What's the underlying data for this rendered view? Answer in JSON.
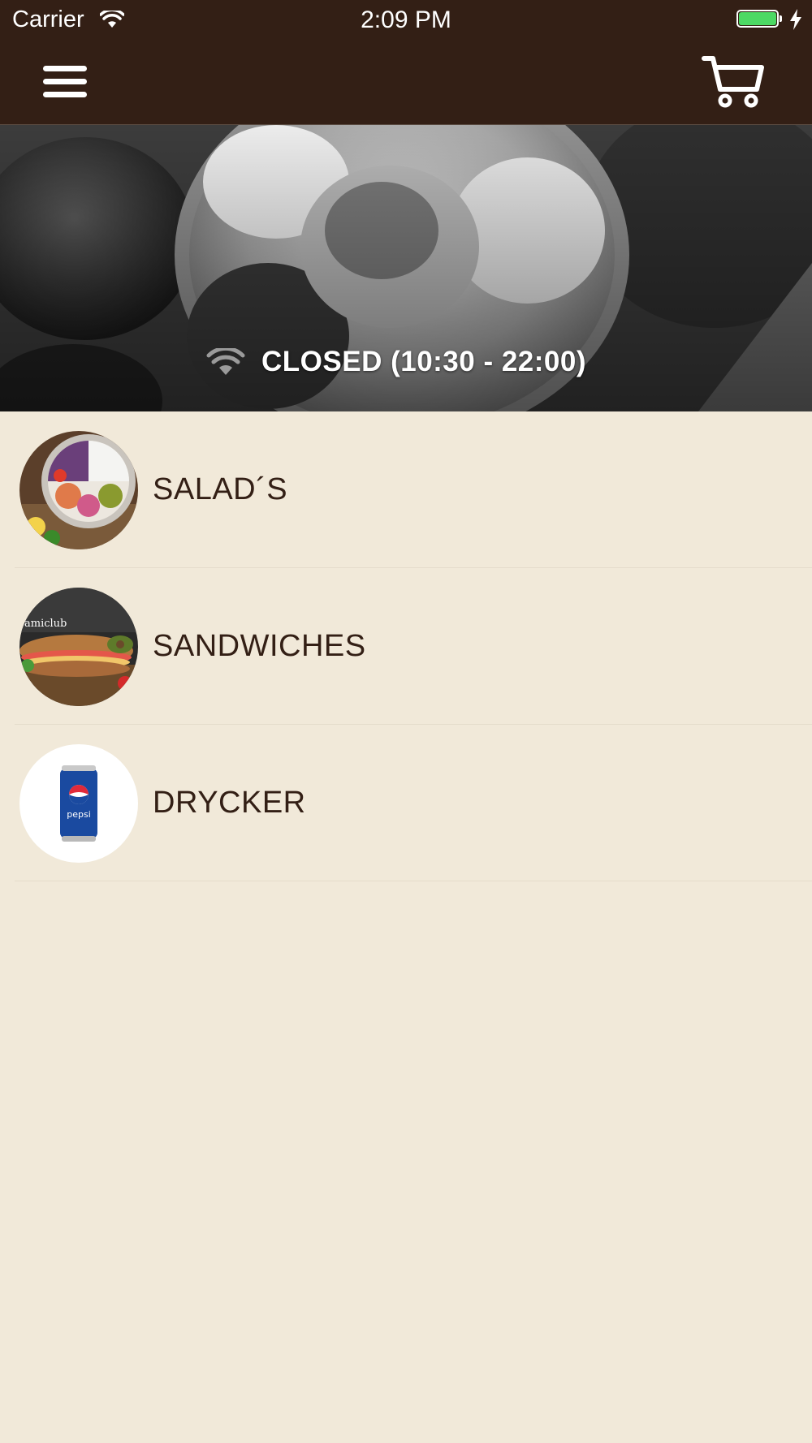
{
  "status_bar": {
    "carrier": "Carrier",
    "time": "2:09 PM",
    "battery_level": 1.0,
    "battery_color": "#4cd964"
  },
  "navbar": {
    "background": "#331f15",
    "menu_icon": "hamburger-menu-icon",
    "cart_icon": "shopping-cart-icon"
  },
  "hero": {
    "status_text": "CLOSED (10:30 - 22:00)",
    "status_icon": "wifi-icon"
  },
  "categories": [
    {
      "label": "SALAD´S",
      "image": "salad-bowl-photo"
    },
    {
      "label": "SANDWICHES",
      "image": "sandwich-photo"
    },
    {
      "label": "DRYCKER",
      "image": "pepsi-can-photo"
    }
  ],
  "colors": {
    "page_background": "#f1e9d9",
    "text_primary": "#331f15"
  }
}
